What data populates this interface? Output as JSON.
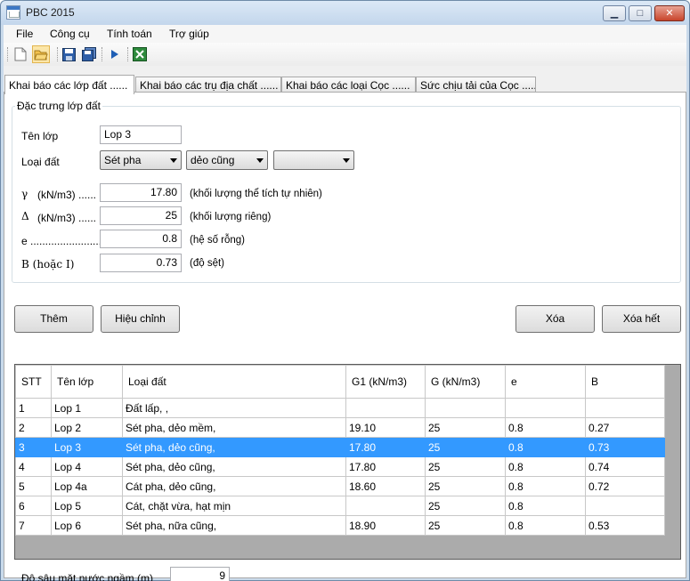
{
  "window": {
    "title": "PBC 2015",
    "min_glyph": "▁",
    "max_glyph": "□",
    "close_glyph": "✕"
  },
  "menu": [
    "File",
    "Công cụ",
    "Tính toán",
    "Trợ giúp"
  ],
  "toolbar": [
    "new-icon",
    "open-icon",
    "save-icon",
    "save-all-icon",
    "run-icon",
    "excel-icon"
  ],
  "tabs": [
    "Khai báo các lớp đất ......",
    "Khai báo các trụ địa chất ......",
    "Khai báo các loại Cọc ......",
    "Sức chịu tải của Cọc ......"
  ],
  "group": {
    "legend": "Đặc trưng lớp đất",
    "ten_lop_label": "Tên lớp",
    "ten_lop_value": "Lop 3",
    "loai_dat_label": "Loại đất",
    "loai_dat_1": "Sét pha",
    "loai_dat_2": "dẻo cũng",
    "loai_dat_3": "",
    "gamma_symbol": "γ",
    "gamma_label": "(kN/m3) ......",
    "gamma_value": "17.80",
    "gamma_note": "(khối lượng thể tích tự nhiên)",
    "delta_symbol": "Δ",
    "delta_label": "(kN/m3) ......",
    "delta_value": "25",
    "delta_note": "(khối lượng riêng)",
    "e_label": "e .........................",
    "e_value": "0.8",
    "e_note": "(hệ số rỗng)",
    "b_label": "B (hoặc I)",
    "b_value": "0.73",
    "b_note": "(độ sệt)"
  },
  "buttons": {
    "them": "Thêm",
    "hieu_chinh": "Hiệu chỉnh",
    "xoa": "Xóa",
    "xoa_het": "Xóa hết"
  },
  "table": {
    "columns": [
      "STT",
      "Tên lớp",
      "Loại đất",
      "G1 (kN/m3)",
      "G (kN/m3)",
      "e",
      "B"
    ],
    "rows": [
      [
        "1",
        "Lop 1",
        "Đất lấp, ,",
        "",
        "",
        "",
        ""
      ],
      [
        "2",
        "Lop 2",
        "Sét pha, dẻo mềm,",
        "19.10",
        "25",
        "0.8",
        "0.27"
      ],
      [
        "3",
        "Lop 3",
        "Sét pha, dẻo cũng,",
        "17.80",
        "25",
        "0.8",
        "0.73"
      ],
      [
        "4",
        "Lop 4",
        "Sét pha, dẻo cũng,",
        "17.80",
        "25",
        "0.8",
        "0.74"
      ],
      [
        "5",
        "Lop 4a",
        "Cát pha, dẻo cũng,",
        "18.60",
        "25",
        "0.8",
        "0.72"
      ],
      [
        "6",
        "Lop 5",
        "Cát, chặt vừa, hạt mịn",
        "",
        "25",
        "0.8",
        ""
      ],
      [
        "7",
        "Lop 6",
        "Sét pha, nữa cũng,",
        "18.90",
        "25",
        "0.8",
        "0.53"
      ]
    ],
    "selected_row": 2
  },
  "footer": {
    "label": "Độ sâu mặt nước ngầm (m)",
    "value": "9"
  }
}
